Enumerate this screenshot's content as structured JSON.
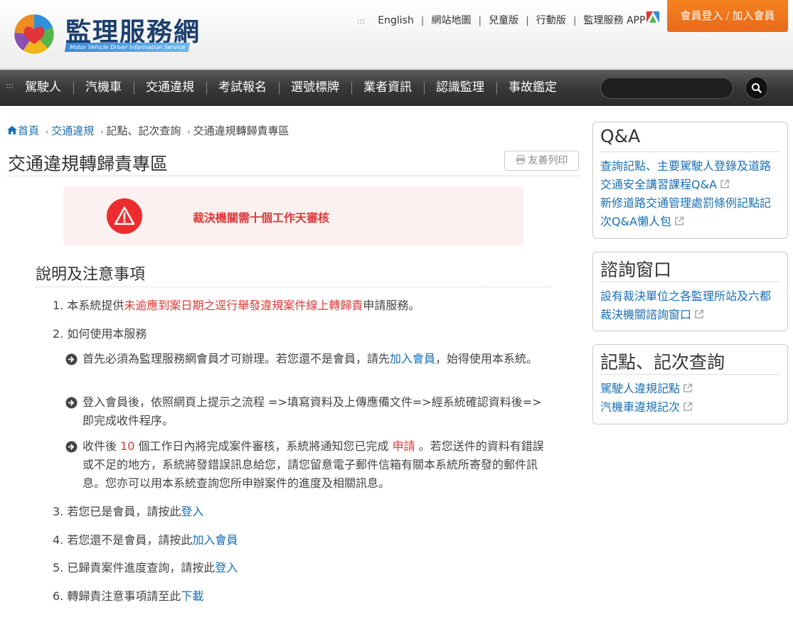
{
  "header": {
    "logo_title": "監理服務網",
    "logo_subtitle": "Motor Vehicle Driver Information Service",
    "toplinks_dots": ":::",
    "toplinks": [
      "English",
      "網站地圖",
      "兒童版",
      "行動版",
      "監理服務 APP"
    ],
    "member_login": "會員登入",
    "member_join": "加入會員",
    "member_slash": "/"
  },
  "nav": {
    "dots": ":::",
    "items": [
      "駕駛人",
      "汽機車",
      "交通違規",
      "考試報名",
      "選號標牌",
      "業者資訊",
      "認識監理",
      "事故鑑定"
    ],
    "search_value": ""
  },
  "breadcrumb": {
    "home": "首頁",
    "items": [
      "交通違規",
      "記點、記次查詢",
      "交通違規轉歸責專區"
    ]
  },
  "page": {
    "title": "交通違規轉歸責專區",
    "print_label": "友善列印",
    "alert": "裁決機關需十個工作天審核",
    "section_title": "說明及注意事項",
    "item1": {
      "num": "1.",
      "pre": "本系統提供",
      "highlight": "未逾應到案日期之逕行舉發違規案件線上轉歸責",
      "post": "申請服務。"
    },
    "item2": {
      "num": "2.",
      "text": "如何使用本服務"
    },
    "sub1": {
      "pre": "首先必須為監理服務網會員才可辦理。若您還不是會員，請先",
      "link": "加入會員",
      "post": "，始得使用本系統。"
    },
    "sub2": {
      "text": "登入會員後，依照網頁上提示之流程 =>填寫資料及上傳應備文件=>經系統確認資料後=>即完成收件程序。"
    },
    "sub3": {
      "pre": "收件後 ",
      "days": "10",
      "mid": " 個工作日內將完成案件審核，系統將通知您已完成 ",
      "apply": "申請",
      "post": " 。若您送件的資料有錯誤或不足的地方，系統將發錯誤訊息給您，請您留意電子郵件信箱有關本系統所寄發的郵件訊息。您亦可以用本系統查詢您所申辦案件的進度及相關訊息。"
    },
    "item3": {
      "num": "3.",
      "pre": "若您已是會員，請按此",
      "link": "登入"
    },
    "item4": {
      "num": "4.",
      "pre": "若您還不是會員，請按此",
      "link": "加入會員"
    },
    "item5": {
      "num": "5.",
      "pre": "已歸責案件進度查詢，請按此",
      "link": "登入"
    },
    "item6": {
      "num": "6.",
      "pre": "轉歸責注意事項請至此",
      "link": "下載"
    }
  },
  "sidebar": {
    "qa": {
      "title": "Q&A",
      "links": [
        "查詢記點、主要駕駛人登錄及道路交通安全講習課程Q&A",
        "新修道路交通管理處罰條例記點記次Q&A懶人包"
      ]
    },
    "consult": {
      "title": "諮詢窗口",
      "links": [
        "設有裁決單位之各監理所站及六都裁決機關諮詢窗口"
      ]
    },
    "points": {
      "title": "記點、記次查詢",
      "links": [
        "駕駛人違規記點",
        "汽機車違規記次"
      ]
    }
  },
  "colors": {
    "accent": "#1a6fb3",
    "alert_red": "#d93a3a",
    "orange": "#f58220",
    "nav_bg": "#3a3a3a"
  }
}
